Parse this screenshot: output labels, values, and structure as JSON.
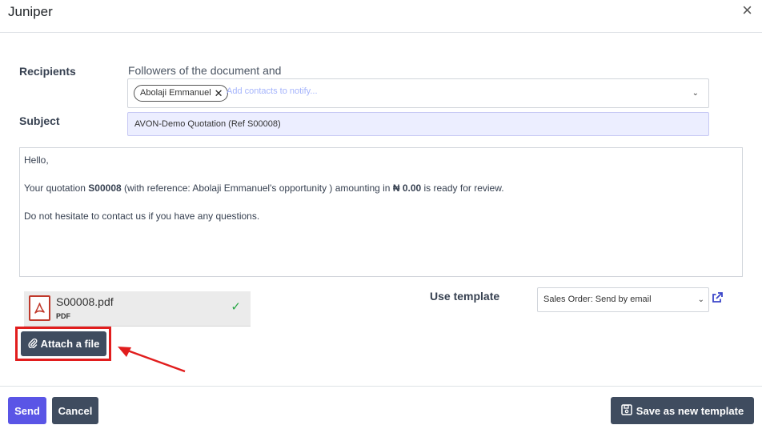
{
  "dialog": {
    "title": "Juniper",
    "close_icon": "×"
  },
  "recipients": {
    "label": "Recipients",
    "followers_text": "Followers of the document and",
    "tags": [
      {
        "name": "Abolaji Emmanuel"
      }
    ],
    "placeholder": "Add contacts to notify..."
  },
  "subject": {
    "label": "Subject",
    "value": "AVON-Demo Quotation (Ref S00008)"
  },
  "body": {
    "greeting": "Hello,",
    "line1_prefix": "Your quotation ",
    "quote_ref": "S00008",
    "line1_middle": " (with reference: Abolaji Emmanuel's opportunity ) amounting in ",
    "amount": "₦ 0.00",
    "line1_suffix": " is ready for review.",
    "line2": "Do not hesitate to contact us if you have any questions."
  },
  "attachment": {
    "filename": "S00008.pdf",
    "type": "PDF"
  },
  "attach_button": {
    "label": "Attach a file"
  },
  "template": {
    "label": "Use template",
    "selected": "Sales Order: Send by email"
  },
  "footer": {
    "send_label": "Send",
    "cancel_label": "Cancel",
    "save_template_label": "Save as new template"
  },
  "colors": {
    "primary": "#5a55e6",
    "secondary": "#3f4c5f",
    "subject_bg": "#eceeff",
    "annotation_red": "#e11d1d",
    "success": "#28a745"
  }
}
